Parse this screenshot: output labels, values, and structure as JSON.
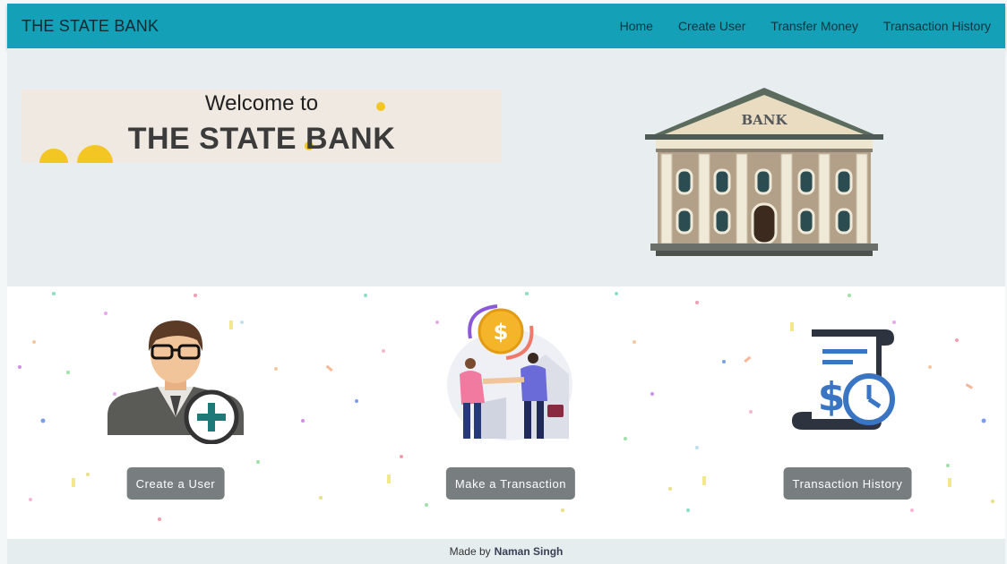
{
  "brand": "THE STATE BANK",
  "nav": {
    "home": "Home",
    "create_user": "Create User",
    "transfer_money": "Transfer Money",
    "transaction_history": "Transaction History"
  },
  "hero": {
    "welcome_to": "Welcome to",
    "title": "THE STATE BANK",
    "building_sign": "BANK"
  },
  "features": {
    "create_user_button": "Create a User",
    "make_transaction_button": "Make a Transaction",
    "transaction_history_button": "Transaction History",
    "icons": [
      "user-add-icon",
      "transaction-handshake-icon",
      "transaction-history-icon"
    ]
  },
  "footer": {
    "made_by": "Made by",
    "author": "Naman Singh"
  },
  "colors": {
    "navbar": "#14a0b6",
    "button": "#787d80",
    "accent_teal": "#1e7a78",
    "accent_blue": "#3a75c4",
    "coin_yellow": "#f4c623"
  }
}
